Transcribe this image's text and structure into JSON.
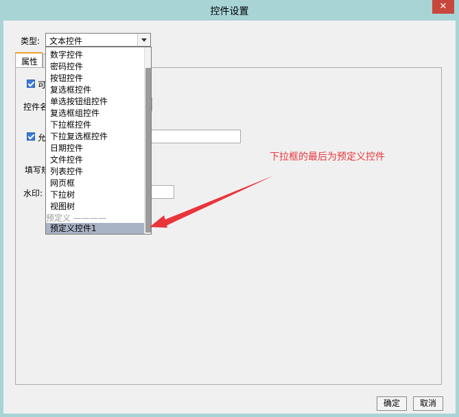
{
  "window": {
    "title": "控件设置",
    "close": "✕"
  },
  "type_row": {
    "label": "类型:",
    "value": "文本控件"
  },
  "tabs": [
    {
      "label": "属性"
    }
  ],
  "panel": {
    "checkbox1_label": "可",
    "name_label": "控件名",
    "checkbox2_label": "允",
    "fill_label": "填写规",
    "watermark_label": "水印:"
  },
  "dropdown": {
    "items": [
      "数字控件",
      "密码控件",
      "按钮控件",
      "复选框控件",
      "单选按钮组控件",
      "复选框组控件",
      "下拉框控件",
      "下拉复选框控件",
      "日期控件",
      "文件控件",
      "列表控件",
      "网页框",
      "下拉树",
      "视图树"
    ],
    "separator": "预定义 ————",
    "selected": "预定义控件1"
  },
  "annotation": {
    "text": "下拉框的最后为预定义控件",
    "color": "#e8353a"
  },
  "buttons": {
    "ok": "确定",
    "cancel": "取消"
  }
}
